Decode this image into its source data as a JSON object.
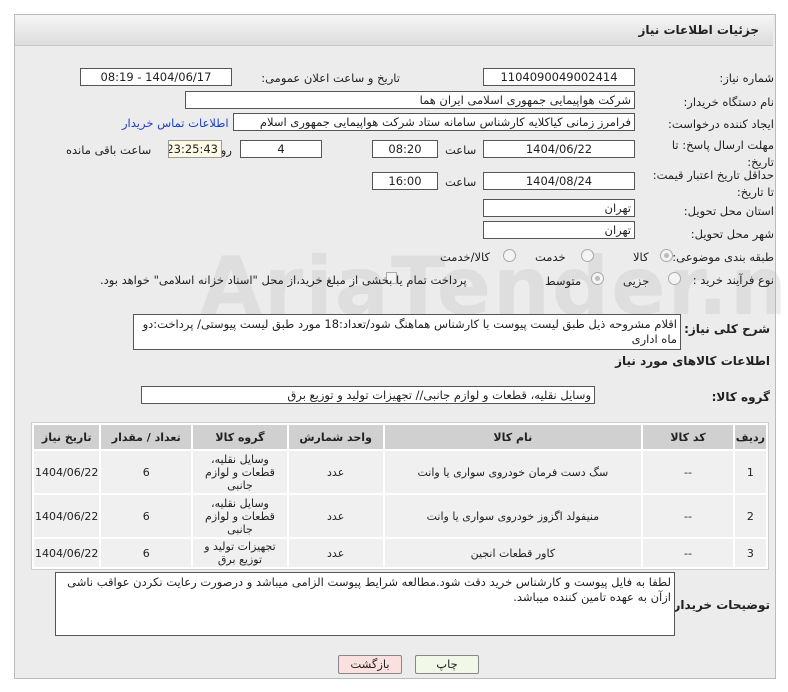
{
  "header": {
    "title": "جزئیات اطلاعات نیاز"
  },
  "fields": {
    "need_number_label": "شماره نیاز:",
    "need_number": "1104090049002414",
    "announce_label": "تاریخ و ساعت اعلان عمومی:",
    "announce_value": "1404/06/17 - 08:19",
    "buyer_label": "نام دستگاه خریدار:",
    "buyer_value": "شرکت هواپیمایی جمهوری اسلامی ایران هما",
    "creator_label": "ایجاد کننده درخواست:",
    "creator_value": "فرامرز زمانی کیاکلایه کارشناس سامانه ستاد شرکت هواپیمایی جمهوری اسلام",
    "contact_link": "اطلاعات تماس خریدار",
    "deadline_label": "مهلت ارسال پاسخ: تا تاریخ:",
    "deadline_date": "1404/06/22",
    "time_label": "ساعت",
    "deadline_time": "08:20",
    "days": "4",
    "days_label": "روز و",
    "remaining": "23:25:43",
    "remaining_label": "ساعت باقی مانده",
    "validity_label": "حداقل تاریخ اعتبار قیمت: تا تاریخ:",
    "validity_date": "1404/08/24",
    "validity_time": "16:00",
    "province_label": "استان محل تحویل:",
    "province": "تهران",
    "city_label": "شهر محل تحویل:",
    "city": "تهران",
    "category_label": "طبقه بندی موضوعی:",
    "category_options": [
      "کالا",
      "خدمت",
      "کالا/خدمت"
    ],
    "category_selected": "کالا",
    "process_label": "نوع فرآیند خرید :",
    "process_options": [
      "جزیی",
      "متوسط"
    ],
    "process_selected": "متوسط",
    "payment_note": "پرداخت تمام یا بخشی از مبلغ خرید،از محل \"اسناد خزانه اسلامی\" خواهد بود.",
    "desc_label": "شرح کلی نیاز:",
    "desc_value": "اقلام مشروحه ذیل طبق لیست پیوست با کارشناس هماهنگ شود/تعداد:18 مورد طبق لیست پیوستی/ پرداخت:دو ماه اداری",
    "goods_section": "اطلاعات کالاهای مورد نیاز",
    "group_label": "گروه کالا:",
    "group_value": "وسایل نقلیه، قطعات و لوازم جانبی// تجهیزات تولید و توزیع برق"
  },
  "table": {
    "headers": [
      "ردیف",
      "کد کالا",
      "نام کالا",
      "واحد شمارش",
      "گروه کالا",
      "تعداد / مقدار",
      "تاریخ نیاز"
    ],
    "rows": [
      [
        "1",
        "--",
        "سگ دست فرمان خودروی سواری یا وانت",
        "عدد",
        "وسایل نقلیه، قطعات و لوازم جانبی",
        "6",
        "1404/06/22"
      ],
      [
        "2",
        "--",
        "منیفولد اگزوز خودروی سواری یا وانت",
        "عدد",
        "وسایل نقلیه، قطعات و لوازم جانبی",
        "6",
        "1404/06/22"
      ],
      [
        "3",
        "--",
        "کاور قطعات انجین",
        "عدد",
        "تجهیزات تولید و توزیع برق",
        "6",
        "1404/06/22"
      ]
    ]
  },
  "notes": {
    "label": "توضیحات خریدار:",
    "value": "لطفا به فایل پیوست و کارشناس خرید دقت شود.مطالعه شرایط پیوست الزامی میباشد و درصورت رعایت نکردن عواقب ناشی ازآن به عهده تامین کننده میباشد."
  },
  "buttons": {
    "print": "چاپ",
    "back": "بازگشت"
  },
  "watermark": "AriaTender.net"
}
